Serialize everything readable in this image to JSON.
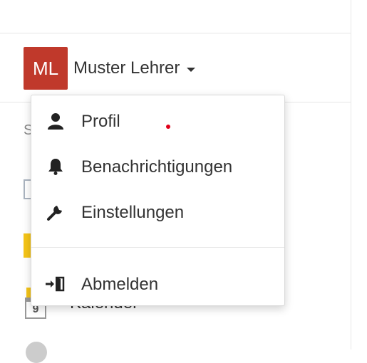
{
  "user": {
    "initials": "ML",
    "name": "Muster Lehrer",
    "avatar_color": "#c0392b"
  },
  "menu": {
    "items": [
      {
        "label": "Profil",
        "icon": "user-icon",
        "has_notification_dot": true
      },
      {
        "label": "Benachrichtigungen",
        "icon": "bell-icon"
      },
      {
        "label": "Einstellungen",
        "icon": "wrench-icon"
      }
    ],
    "logout": {
      "label": "Abmelden",
      "icon": "logout-icon"
    }
  },
  "background": {
    "kalender_label": "Kalender",
    "s_letter": "S",
    "calendar_day": "9"
  },
  "colors": {
    "notification_dot": "#e0001a",
    "accent_yellow": "#f5c518"
  }
}
